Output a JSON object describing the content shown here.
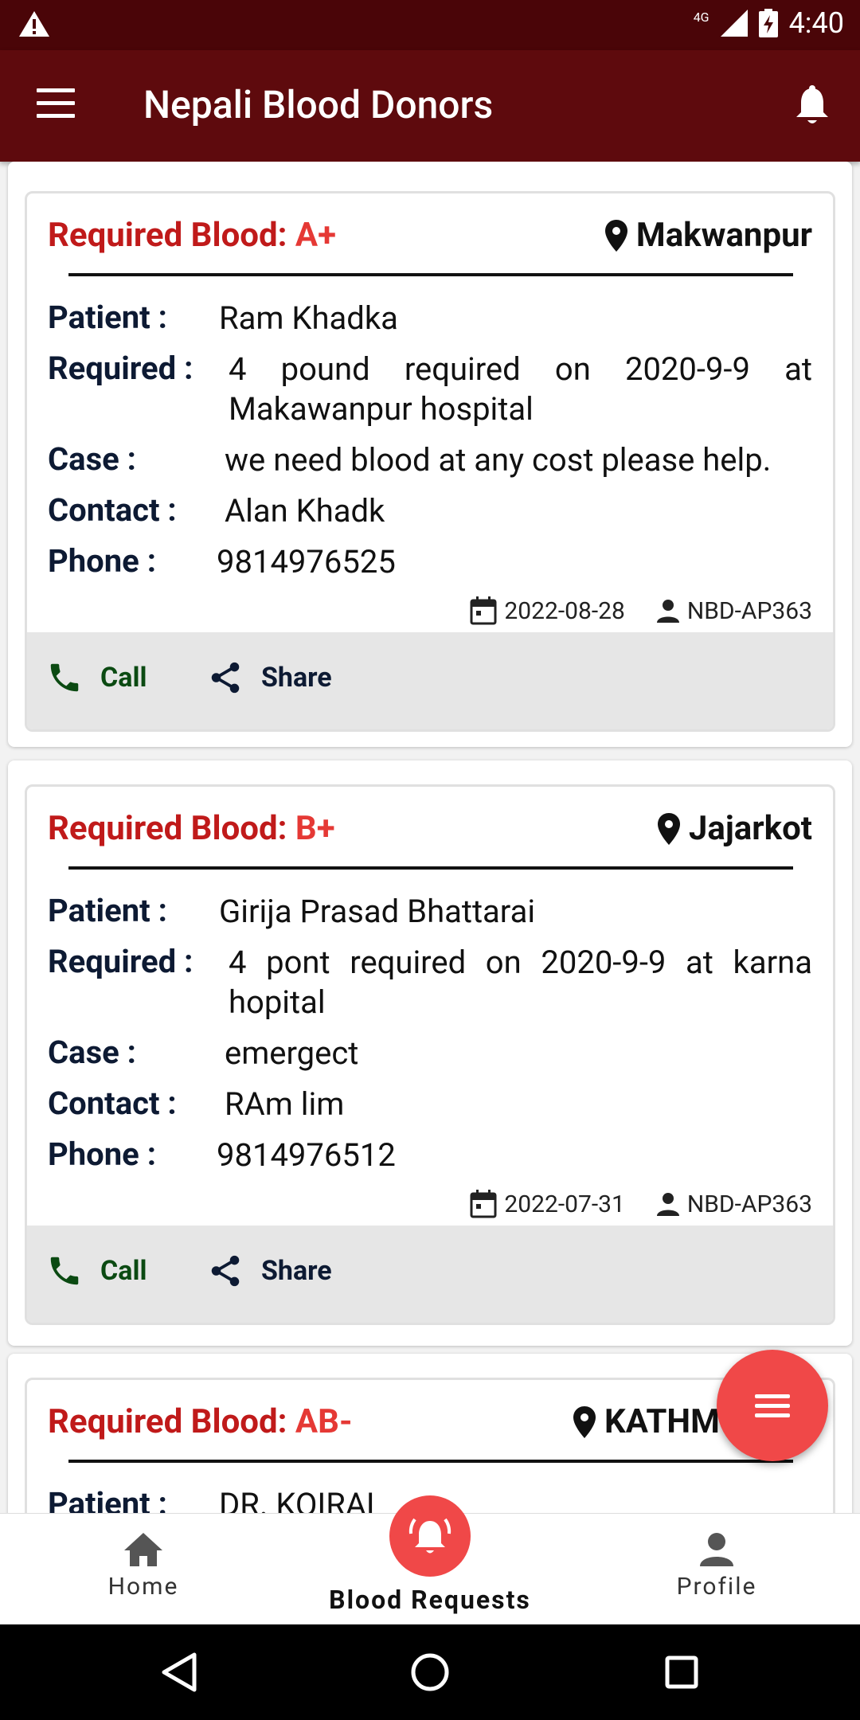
{
  "status": {
    "network": "4G",
    "time": "4:40"
  },
  "app": {
    "title": "Nepali Blood Donors"
  },
  "labels": {
    "required_blood": "Required Blood: ",
    "patient": "Patient :",
    "required": "Required :",
    "case": "Case :",
    "contact": "Contact :",
    "phone": "Phone :",
    "call": "Call",
    "share": "Share"
  },
  "requests": [
    {
      "blood_group": "A+",
      "location": "Makwanpur",
      "patient": "Ram Khadka",
      "required": "4 pound required on 2020-9-9 at Makawanpur hospital",
      "case": "we need blood at any cost please help.",
      "contact": "Alan Khadk",
      "phone": "9814976525",
      "date": "2022-08-28",
      "user": "NBD-AP363"
    },
    {
      "blood_group": "B+",
      "location": "Jajarkot",
      "patient": "Girija Prasad Bhattarai",
      "required": "4 pont required on 2020-9-9 at karna hopital",
      "case": "emergect",
      "contact": "RAm lim",
      "phone": "9814976512",
      "date": "2022-07-31",
      "user": "NBD-AP363"
    },
    {
      "blood_group": "AB-",
      "location": "KATHM",
      "patient": "DR. KOIRAL"
    }
  ],
  "bottom_nav": {
    "home": "Home",
    "blood_requests": "Blood Requests",
    "profile": "Profile"
  },
  "colors": {
    "appbar": "#5e0a0d",
    "accent": "#c01a1a",
    "fab": "#f04848",
    "call_green": "#0b4a12"
  }
}
